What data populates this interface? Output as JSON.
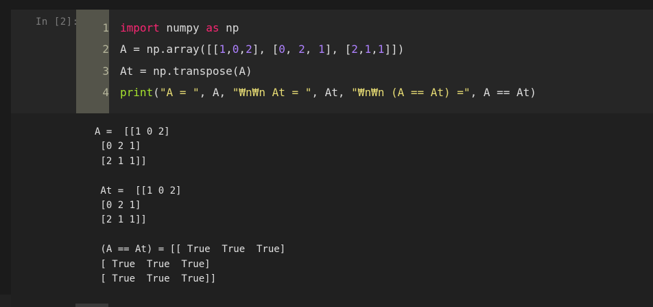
{
  "cell": {
    "prompt": "In [2]:",
    "code_lines": [
      {
        "num": "1",
        "tokens": [
          {
            "t": "import",
            "c": "kw"
          },
          {
            "t": " numpy ",
            "c": ""
          },
          {
            "t": "as",
            "c": "kw"
          },
          {
            "t": " np",
            "c": ""
          }
        ]
      },
      {
        "num": "2",
        "tokens": [
          {
            "t": "A = np.array([[",
            "c": ""
          },
          {
            "t": "1",
            "c": "num"
          },
          {
            "t": ",",
            "c": ""
          },
          {
            "t": "0",
            "c": "num"
          },
          {
            "t": ",",
            "c": ""
          },
          {
            "t": "2",
            "c": "num"
          },
          {
            "t": "], [",
            "c": ""
          },
          {
            "t": "0",
            "c": "num"
          },
          {
            "t": ", ",
            "c": ""
          },
          {
            "t": "2",
            "c": "num"
          },
          {
            "t": ", ",
            "c": ""
          },
          {
            "t": "1",
            "c": "num"
          },
          {
            "t": "], [",
            "c": ""
          },
          {
            "t": "2",
            "c": "num"
          },
          {
            "t": ",",
            "c": ""
          },
          {
            "t": "1",
            "c": "num"
          },
          {
            "t": ",",
            "c": ""
          },
          {
            "t": "1",
            "c": "num"
          },
          {
            "t": "]])",
            "c": ""
          }
        ]
      },
      {
        "num": "3",
        "tokens": [
          {
            "t": "At = np.transpose(A)",
            "c": ""
          }
        ]
      },
      {
        "num": "4",
        "tokens": [
          {
            "t": "print",
            "c": "fn"
          },
          {
            "t": "(",
            "c": ""
          },
          {
            "t": "\"A = \"",
            "c": "str"
          },
          {
            "t": ", A, ",
            "c": ""
          },
          {
            "t": "\"₩n₩n At = \"",
            "c": "str"
          },
          {
            "t": ", At, ",
            "c": ""
          },
          {
            "t": "\"₩n₩n (A == At) =\"",
            "c": "str"
          },
          {
            "t": ", A == At)",
            "c": ""
          }
        ]
      }
    ],
    "output_lines": [
      "A =  [[1 0 2]",
      " [0 2 1]",
      " [2 1 1]]",
      "",
      " At =  [[1 0 2]",
      " [0 2 1]",
      " [2 1 1]]",
      "",
      " (A == At) = [[ True  True  True]",
      " [ True  True  True]",
      " [ True  True  True]]"
    ]
  },
  "colors": {
    "keyword": "#f92672",
    "number": "#ae81ff",
    "string": "#e6db74",
    "function": "#a6e22e",
    "background": "#1b1b1b",
    "gutter": "#54544a"
  }
}
